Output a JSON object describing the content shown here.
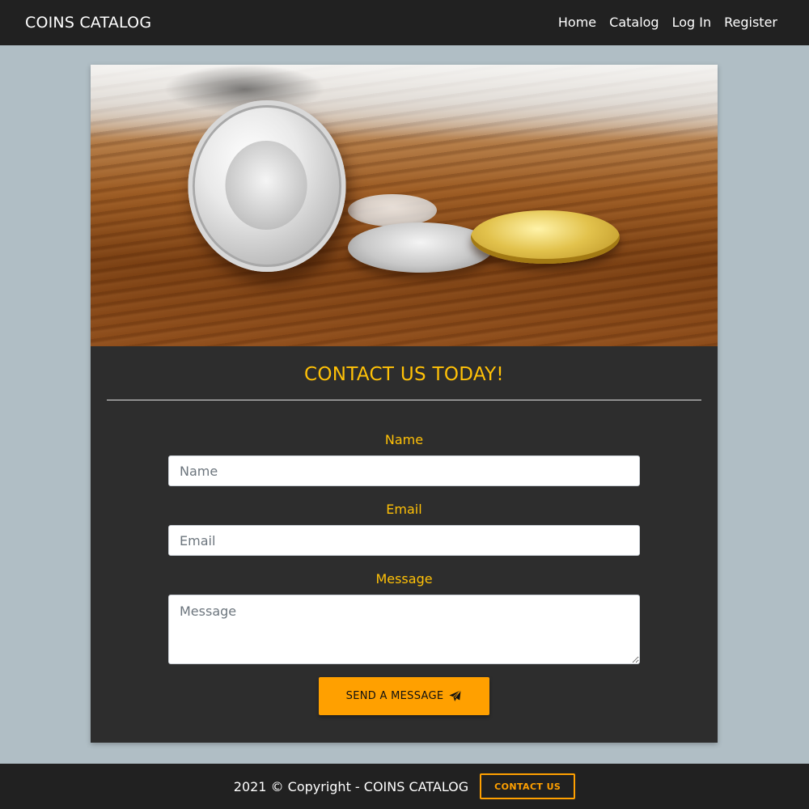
{
  "navbar": {
    "brand": "COINS CATALOG",
    "links": [
      "Home",
      "Catalog",
      "Log In",
      "Register"
    ]
  },
  "hero": {
    "image": "silver-and-gold-coins-on-wooden-table"
  },
  "contact": {
    "title": "CONTACT US TODAY!",
    "name_label": "Name",
    "name_placeholder": "Name",
    "email_label": "Email",
    "email_placeholder": "Email",
    "message_label": "Message",
    "message_placeholder": "Message",
    "send_label": "SEND A MESSAGE",
    "send_icon": "paper-plane-icon"
  },
  "footer": {
    "copyright": "2021 © Copyright -  COINS CATALOG",
    "contact_button": "CONTACT US"
  },
  "colors": {
    "accent": "#ffc107",
    "button": "#ffa000",
    "navbar": "#212121",
    "card": "#2d2d2d",
    "page": "#b0bec5"
  }
}
